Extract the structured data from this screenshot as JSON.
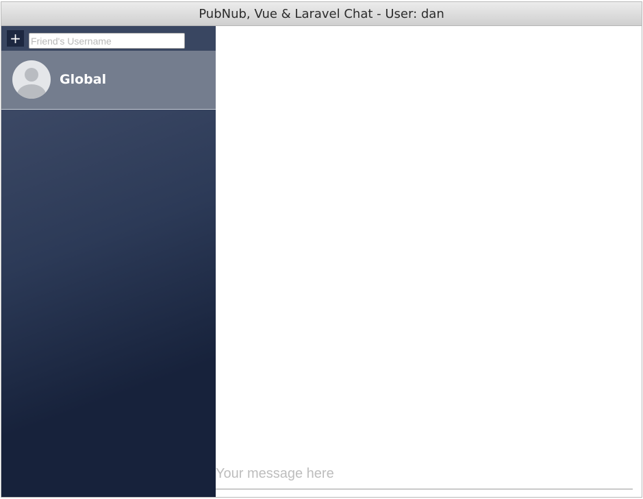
{
  "window": {
    "title": "PubNub, Vue & Laravel Chat - User: dan"
  },
  "sidebar": {
    "add_button_label": "+",
    "username_placeholder": "Friend's Username",
    "contacts": [
      {
        "name": "Global",
        "icon": "user-avatar-icon"
      }
    ]
  },
  "chat": {
    "message_placeholder": "Your message here"
  },
  "colors": {
    "sidebar_top": "#44506c",
    "sidebar_bottom": "#17223b",
    "contact_active": "#747d8e",
    "add_button": "#1c2740"
  }
}
